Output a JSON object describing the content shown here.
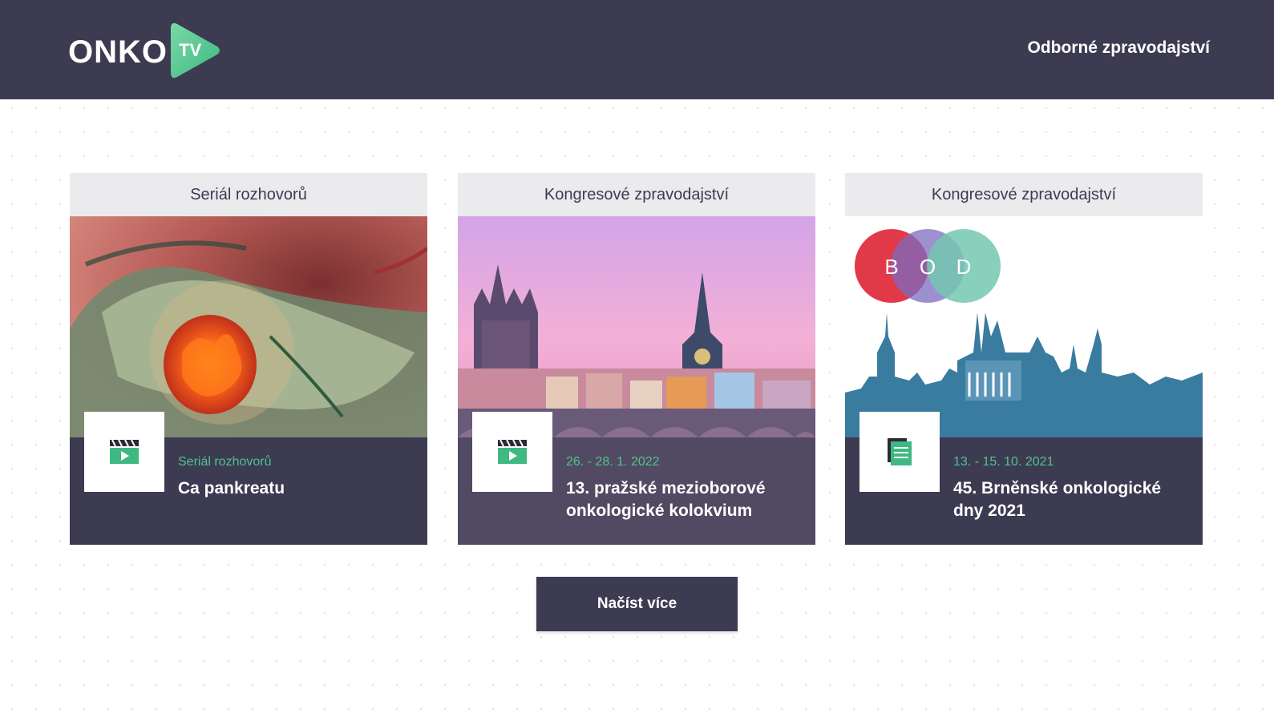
{
  "header": {
    "logo_text": "ONKO",
    "logo_badge": "TV",
    "nav_link": "Odborné zpravodajství"
  },
  "cards": [
    {
      "category": "Seriál rozhovorů",
      "meta": "Seriál rozhovorů",
      "title": "Ca pankreatu",
      "icon": "video-clapper-icon"
    },
    {
      "category": "Kongresové zpravodajství",
      "meta": "26. - 28. 1. 2022",
      "title": "13. pražské mezioborové onkologické kolokvium",
      "icon": "video-clapper-icon"
    },
    {
      "category": "Kongresové zpravodajství",
      "meta": "13. - 15. 10. 2021",
      "title": "45. Brněnské onkologické dny 2021",
      "icon": "document-icon",
      "logo_letters": [
        "B",
        "O",
        "D"
      ]
    }
  ],
  "load_more": "Načíst více",
  "colors": {
    "header_bg": "#3c3b52",
    "accent_green": "#4fc48c",
    "card_info_bg": "#3c3b52",
    "bod_red": "#e0283a",
    "bod_purple": "#7b6bc0",
    "bod_teal": "#74c8b0",
    "skyline_blue": "#3a7ba0"
  }
}
